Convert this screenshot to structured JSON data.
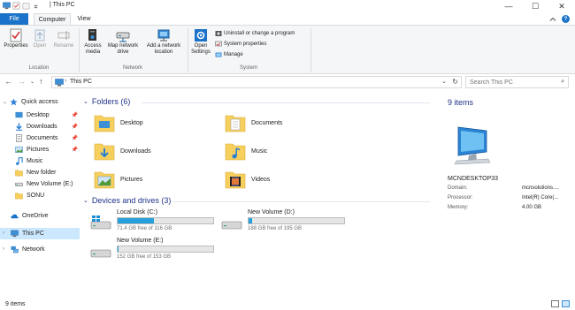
{
  "window": {
    "title": "This PC",
    "title_prefix": "| ",
    "minimize": "—",
    "maximize": "☐",
    "close": "✕"
  },
  "ribbon_tabs": {
    "file": "File",
    "computer": "Computer",
    "view": "View"
  },
  "ribbon": {
    "location": {
      "label": "Location",
      "properties": "Properties",
      "open": "Open",
      "rename": "Rename"
    },
    "network": {
      "label": "Network",
      "access_media": "Access media",
      "map_network_drive": "Map network drive",
      "add_network_location": "Add a network location"
    },
    "system": {
      "label": "System",
      "open_settings": "Open Settings",
      "uninstall": "Uninstall or change a program",
      "system_properties": "System properties",
      "manage": "Manage"
    }
  },
  "address": {
    "path": "This PC",
    "separator": "›"
  },
  "search": {
    "placeholder": "Search This PC"
  },
  "nav": {
    "quick_access": "Quick access",
    "items": [
      {
        "label": "Desktop",
        "pinned": true
      },
      {
        "label": "Downloads",
        "pinned": true
      },
      {
        "label": "Documents",
        "pinned": true
      },
      {
        "label": "Pictures",
        "pinned": true
      },
      {
        "label": "Music",
        "pinned": false
      },
      {
        "label": "New folder",
        "pinned": false
      },
      {
        "label": "New Volume (E:)",
        "pinned": false
      },
      {
        "label": "SONU",
        "pinned": false
      }
    ],
    "onedrive": "OneDrive",
    "this_pc": "This PC",
    "network": "Network"
  },
  "folders": {
    "header": "Folders (6)",
    "items": [
      "Desktop",
      "Documents",
      "Downloads",
      "Music",
      "Pictures",
      "Videos"
    ]
  },
  "drives": {
    "header": "Devices and drives (3)",
    "items": [
      {
        "name": "Local Disk (C:)",
        "free": "71.4 GB free of 116 GB",
        "used_fraction": 0.38
      },
      {
        "name": "New Volume (D:)",
        "free": "188 GB free of 195 GB",
        "used_fraction": 0.04
      },
      {
        "name": "New Volume (E:)",
        "free": "152 GB free of 153 GB",
        "used_fraction": 0.01
      }
    ]
  },
  "details": {
    "count": "9 items",
    "computer_name": "MCNDESKTOP33",
    "domain_label": "Domain:",
    "domain_value": "mcnsolutions....",
    "processor_label": "Processor:",
    "processor_value": "Intel(R) Core(...",
    "memory_label": "Memory:",
    "memory_value": "4.00 GB"
  },
  "status": {
    "count": "9 items"
  },
  "colors": {
    "accent": "#1a73c8",
    "drive_fill": "#26a0da",
    "header_text": "#1e3287",
    "selection": "#cce8ff"
  }
}
